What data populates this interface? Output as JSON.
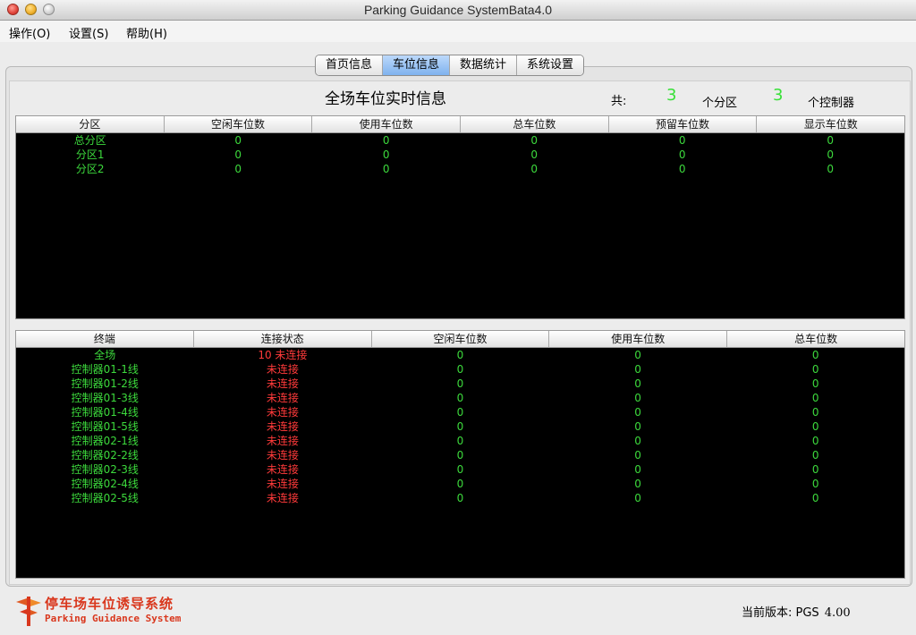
{
  "window": {
    "title": "Parking Guidance SystemBata4.0"
  },
  "menu": [
    "操作(O)",
    "设置(S)",
    "帮助(H)"
  ],
  "tabs": [
    "首页信息",
    "车位信息",
    "数据统计",
    "系统设置"
  ],
  "active_tab": 1,
  "page": {
    "title": "全场车位实时信息",
    "total_label": "共:",
    "zone_count": "3",
    "zone_label": "个分区",
    "controller_count": "3",
    "controller_label": "个控制器"
  },
  "zones_table": {
    "headers": [
      "分区",
      "空闲车位数",
      "使用车位数",
      "总车位数",
      "预留车位数",
      "显示车位数"
    ],
    "rows": [
      [
        "总分区",
        "0",
        "0",
        "0",
        "0",
        "0"
      ],
      [
        "分区1",
        "0",
        "0",
        "0",
        "0",
        "0"
      ],
      [
        "分区2",
        "0",
        "0",
        "0",
        "0",
        "0"
      ]
    ]
  },
  "terminals_table": {
    "headers": [
      "终端",
      "连接状态",
      "空闲车位数",
      "使用车位数",
      "总车位数"
    ],
    "rows": [
      [
        "全场",
        "10 未连接",
        "0",
        "0",
        "0"
      ],
      [
        "控制器01-1线",
        "未连接",
        "0",
        "0",
        "0"
      ],
      [
        "控制器01-2线",
        "未连接",
        "0",
        "0",
        "0"
      ],
      [
        "控制器01-3线",
        "未连接",
        "0",
        "0",
        "0"
      ],
      [
        "控制器01-4线",
        "未连接",
        "0",
        "0",
        "0"
      ],
      [
        "控制器01-5线",
        "未连接",
        "0",
        "0",
        "0"
      ],
      [
        "控制器02-1线",
        "未连接",
        "0",
        "0",
        "0"
      ],
      [
        "控制器02-2线",
        "未连接",
        "0",
        "0",
        "0"
      ],
      [
        "控制器02-3线",
        "未连接",
        "0",
        "0",
        "0"
      ],
      [
        "控制器02-4线",
        "未连接",
        "0",
        "0",
        "0"
      ],
      [
        "控制器02-5线",
        "未连接",
        "0",
        "0",
        "0"
      ]
    ]
  },
  "footer": {
    "logo_cn": "停车场车位诱导系统",
    "logo_en": "Parking Guidance System",
    "version_label": "当前版本: PGS",
    "version": "4.00"
  },
  "colors": {
    "data_text": "#3cd93c",
    "status_text": "#ff3a3a",
    "active_tab": "#7fb2ee"
  }
}
